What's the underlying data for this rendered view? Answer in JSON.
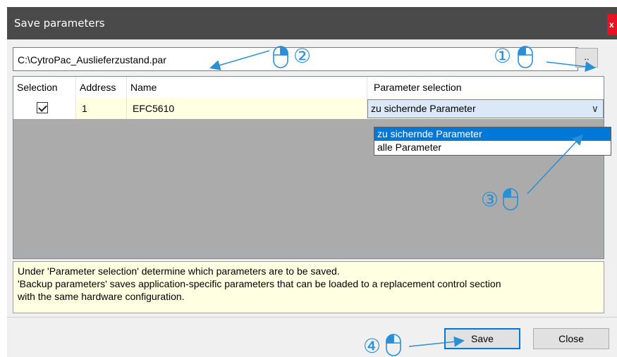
{
  "window": {
    "title": "Save parameters",
    "close_glyph": "x"
  },
  "file_path": {
    "value": "C:\\CytroPac_Auslieferzustand.par",
    "browse_label": ".."
  },
  "table": {
    "columns": [
      "Selection",
      "Address",
      "Name",
      "Parameter selection"
    ],
    "rows": [
      {
        "selected": true,
        "address": "1",
        "name": "EFC5610",
        "parameter_selection": "zu sichernde Parameter"
      }
    ]
  },
  "dropdown": {
    "options": [
      "zu sichernde Parameter",
      "alle Parameter"
    ],
    "highlighted_index": 0
  },
  "help": {
    "lines": [
      "Under 'Parameter selection' determine which parameters are to be saved.",
      "'Backup parameters' saves application-specific parameters that can be loaded to a replacement control section",
      "with the same hardware configuration."
    ]
  },
  "buttons": {
    "save": "Save",
    "close": "Close"
  },
  "annotations": {
    "steps": [
      "①",
      "②",
      "③",
      "④"
    ],
    "accent_color": "#2b8fd6"
  }
}
